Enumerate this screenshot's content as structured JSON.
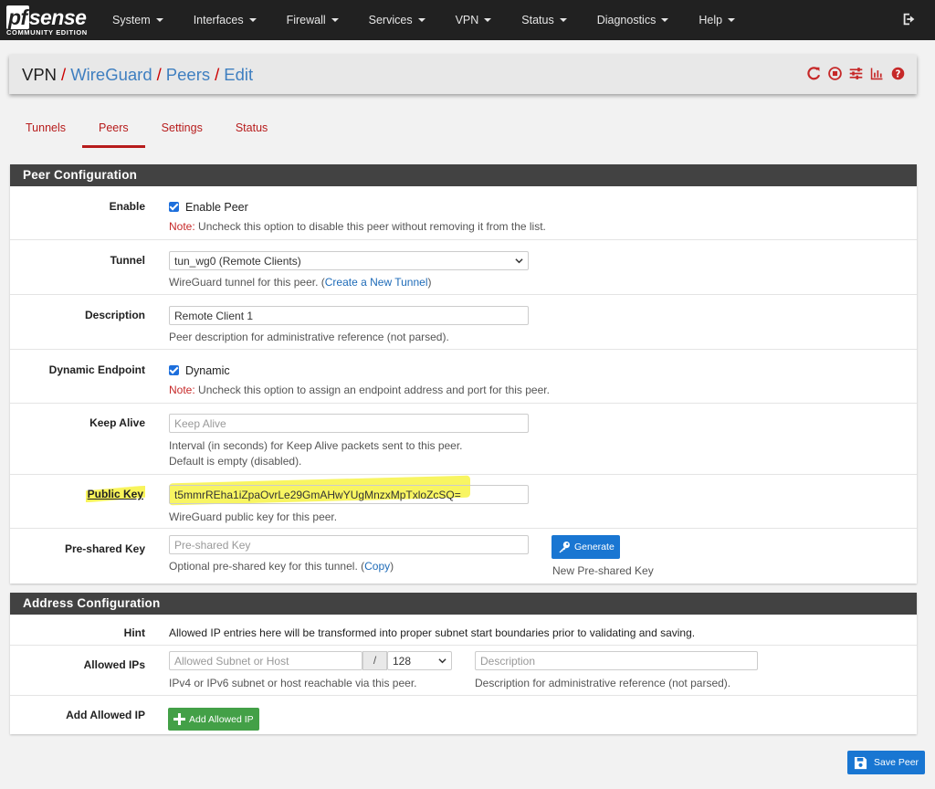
{
  "brand": {
    "logo_main": "sense",
    "logo_pf": "pf",
    "logo_sub": "COMMUNITY EDITION"
  },
  "nav": {
    "items": [
      {
        "label": "System"
      },
      {
        "label": "Interfaces"
      },
      {
        "label": "Firewall"
      },
      {
        "label": "Services"
      },
      {
        "label": "VPN"
      },
      {
        "label": "Status"
      },
      {
        "label": "Diagnostics"
      },
      {
        "label": "Help"
      }
    ],
    "logout_icon": "logout-icon"
  },
  "breadcrumb": {
    "root": "VPN",
    "sep": "/",
    "items": [
      "WireGuard",
      "Peers",
      "Edit"
    ],
    "icons": [
      "restart-icon",
      "stop-icon",
      "sliders-icon",
      "chart-icon",
      "help-icon"
    ]
  },
  "tabs": [
    {
      "label": "Tunnels",
      "active": false
    },
    {
      "label": "Peers",
      "active": true
    },
    {
      "label": "Settings",
      "active": false
    },
    {
      "label": "Status",
      "active": false
    }
  ],
  "peer_config": {
    "heading": "Peer Configuration",
    "enable": {
      "label": "Enable",
      "checkbox_label": "Enable Peer",
      "note_prefix": "Note:",
      "note_text": " Uncheck this option to disable this peer without removing it from the list."
    },
    "tunnel": {
      "label": "Tunnel",
      "value": "tun_wg0 (Remote Clients)",
      "help_prefix": "WireGuard tunnel for this peer. (",
      "help_link": "Create a New Tunnel",
      "help_suffix": ")"
    },
    "description": {
      "label": "Description",
      "value": "Remote Client 1",
      "help": "Peer description for administrative reference (not parsed)."
    },
    "dynamic_endpoint": {
      "label": "Dynamic Endpoint",
      "checkbox_label": "Dynamic",
      "note_prefix": "Note:",
      "note_text": " Uncheck this option to assign an endpoint address and port for this peer."
    },
    "keep_alive": {
      "label": "Keep Alive",
      "placeholder": "Keep Alive",
      "help_line1": "Interval (in seconds) for Keep Alive packets sent to this peer.",
      "help_line2": "Default is empty (disabled)."
    },
    "public_key": {
      "label": "Public Key",
      "value": "t5mmrREha1iZpaOvrLe29GmAHwYUgMnzxMpTxloZcSQ=",
      "help": "WireGuard public key for this peer."
    },
    "preshared_key": {
      "label": "Pre-shared Key",
      "placeholder": "Pre-shared Key",
      "help_prefix": "Optional pre-shared key for this tunnel. (",
      "help_link": "Copy",
      "help_suffix": ")",
      "generate_label": "Generate",
      "generate_help": "New Pre-shared Key"
    }
  },
  "address_config": {
    "heading": "Address Configuration",
    "hint": {
      "label": "Hint",
      "text": "Allowed IP entries here will be transformed into proper subnet start boundaries prior to validating and saving."
    },
    "allowed_ips": {
      "label": "Allowed IPs",
      "subnet_placeholder": "Allowed Subnet or Host",
      "slash": "/",
      "mask_value": "128",
      "desc_placeholder": "Description",
      "subnet_help": "IPv4 or IPv6 subnet or host reachable via this peer.",
      "desc_help": "Description for administrative reference (not parsed)."
    },
    "add_allowed_ip": {
      "label": "Add Allowed IP",
      "button_label": "Add Allowed IP"
    }
  },
  "save_button": "Save Peer",
  "colors": {
    "navbar": "#212121",
    "accent_red": "#b71c1c",
    "link_blue": "#3f7fc0",
    "btn_blue": "#1976d2",
    "btn_green": "#43a047",
    "highlight": "#f8f45a"
  }
}
